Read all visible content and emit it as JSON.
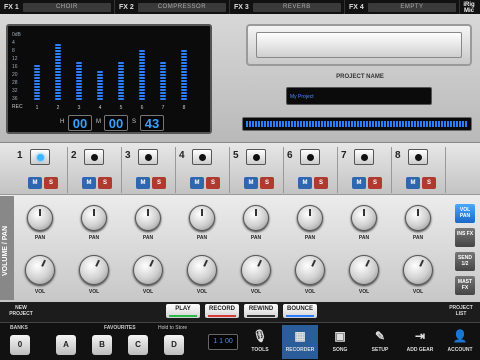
{
  "fx_bar": {
    "slots": [
      {
        "label": "FX 1",
        "value": "CHOIR"
      },
      {
        "label": "FX 2",
        "value": "COMPRESSOR"
      },
      {
        "label": "FX 3",
        "value": "REVERB"
      },
      {
        "label": "FX 4",
        "value": "EMPTY"
      }
    ],
    "logo_line1": "iRig",
    "logo_line2": "Mic"
  },
  "meter": {
    "db_ticks": [
      "0dB",
      "4",
      "8",
      "12",
      "16",
      "20",
      "28",
      "32",
      "36"
    ],
    "rec_label": "REC",
    "channels": [
      "1",
      "2",
      "3",
      "4",
      "5",
      "6",
      "7",
      "8"
    ],
    "levels": [
      0.55,
      0.85,
      0.6,
      0.45,
      0.6,
      0.75,
      0.6,
      0.75
    ],
    "time": {
      "h_label": "H",
      "h": "00",
      "m_label": "M",
      "m": "00",
      "s_label": "S",
      "s": "43"
    }
  },
  "project": {
    "label": "PROJECT NAME",
    "name": "My Project",
    "progress": 1.0
  },
  "channels": [
    {
      "num": "1",
      "armed": true
    },
    {
      "num": "2",
      "armed": false
    },
    {
      "num": "3",
      "armed": false
    },
    {
      "num": "4",
      "armed": false
    },
    {
      "num": "5",
      "armed": false
    },
    {
      "num": "6",
      "armed": false
    },
    {
      "num": "7",
      "armed": false
    },
    {
      "num": "8",
      "armed": false
    }
  ],
  "strip_labels": {
    "mute": "M",
    "solo": "S",
    "pan": "PAN",
    "vol": "VOL",
    "side_title": "VOLUME / PAN"
  },
  "side_buttons": [
    {
      "label": "VOL PAN",
      "active": true
    },
    {
      "label": "INS FX",
      "active": false
    },
    {
      "label": "SEND 1/2",
      "active": false
    },
    {
      "label": "MAST FX",
      "active": false
    }
  ],
  "transport": {
    "new_project": "NEW PROJECT",
    "project_list": "PROJECT LIST",
    "play": "PLAY",
    "record": "RECORD",
    "rewind": "REWIND",
    "bounce": "BOUNCE"
  },
  "bottom": {
    "banks_label": "BANKS",
    "bank_value": "0",
    "favourites_label": "FAVOURITES",
    "hold_label": "Hold to Store",
    "favourites": [
      "A",
      "B",
      "C",
      "D"
    ],
    "lcd": "1 1 00",
    "nav": [
      {
        "label": "TOOLS",
        "icon": "🎙",
        "active": false
      },
      {
        "label": "RECORDER",
        "icon": "▦",
        "active": true
      },
      {
        "label": "SONG",
        "icon": "▣",
        "active": false
      },
      {
        "label": "SETUP",
        "icon": "✎",
        "active": false
      },
      {
        "label": "ADD GEAR",
        "icon": "⇥",
        "active": false
      },
      {
        "label": "ACCOUNT",
        "icon": "👤",
        "active": false
      }
    ]
  },
  "colors": {
    "accent": "#2b7fff",
    "mute": "#2f66b0",
    "solo": "#b03a2f",
    "play": "#2db84a",
    "record": "#d83a3a",
    "bounce": "#2b7fff"
  }
}
